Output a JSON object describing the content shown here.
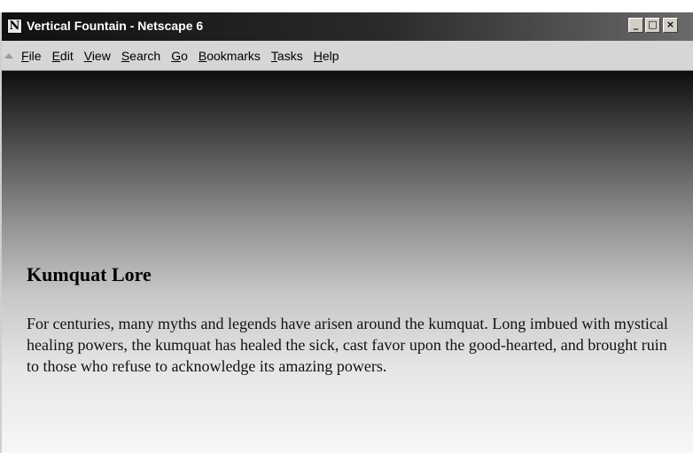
{
  "window": {
    "title": "Vertical Fountain - Netscape 6",
    "app_icon_glyph": "N",
    "controls": {
      "minimize": "_",
      "maximize": "□",
      "close": "×"
    }
  },
  "menubar": {
    "items": [
      {
        "label": "File"
      },
      {
        "label": "Edit"
      },
      {
        "label": "View"
      },
      {
        "label": "Search"
      },
      {
        "label": "Go"
      },
      {
        "label": "Bookmarks"
      },
      {
        "label": "Tasks"
      },
      {
        "label": "Help"
      }
    ]
  },
  "page": {
    "heading": "Kumquat Lore",
    "paragraph": "For centuries, many myths and legends have arisen around the kumquat. Long imbued with mystical healing powers, the kumquat has healed the sick, cast favor upon the good-hearted, and brought ruin to those who refuse to acknowledge its amazing powers.",
    "background_gradient": {
      "direction": "vertical",
      "top_color": "#0e0e0e",
      "bottom_color": "#f7f7f7"
    }
  },
  "colors": {
    "titlebar_dark": "#101010",
    "menubar_bg": "#d6d6d6"
  }
}
